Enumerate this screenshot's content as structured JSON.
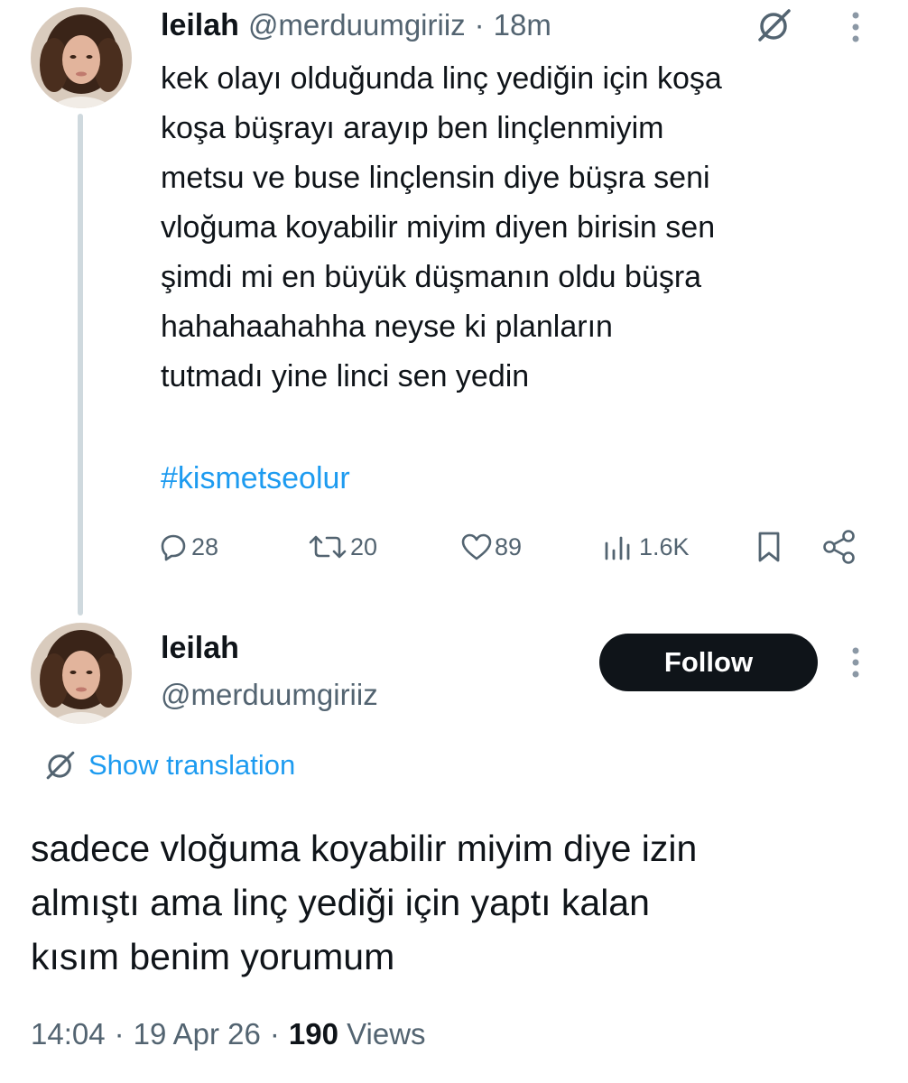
{
  "parent_tweet": {
    "display_name": "leilah",
    "handle": "@merduumgiriiz",
    "separator": "·",
    "time_ago": "18m",
    "lines": [
      "kek olayı olduğunda linç yediğin için koşa",
      "koşa büşrayı arayıp ben linçlenmiyim",
      "metsu ve buse linçlensin diye büşra seni",
      "vloğuma koyabilir miyim diyen birisin sen",
      "şimdi mi en büyük düşmanın oldu büşra",
      "hahahaahahha neyse ki planların",
      "tutmadı yine linci sen yedin"
    ],
    "hashtag": "#kismetseolur",
    "actions": {
      "replies": "28",
      "reposts": "20",
      "likes": "89",
      "views": "1.6K"
    }
  },
  "reply_tweet": {
    "display_name": "leilah",
    "handle": "@merduumgiriiz",
    "follow_label": "Follow",
    "show_translation_label": "Show translation",
    "lines": [
      "sadece vloğuma koyabilir miyim diye izin",
      "almıştı ama linç yediği için yaptı kalan",
      "kısım benim yorumum"
    ],
    "time": "14:04",
    "date": "19 Apr 26",
    "separator": "·",
    "view_count": "190",
    "views_label": "Views"
  },
  "colors": {
    "accent": "#1d9bf0",
    "text_primary": "#0f1419",
    "text_secondary": "#536471",
    "thread_line": "#cfd9de",
    "follow_bg": "#0f1419"
  },
  "icons": [
    "grok-translate-icon",
    "more-vertical-icon",
    "reply-icon",
    "repost-icon",
    "like-icon",
    "views-icon",
    "bookmark-icon",
    "share-icon"
  ]
}
